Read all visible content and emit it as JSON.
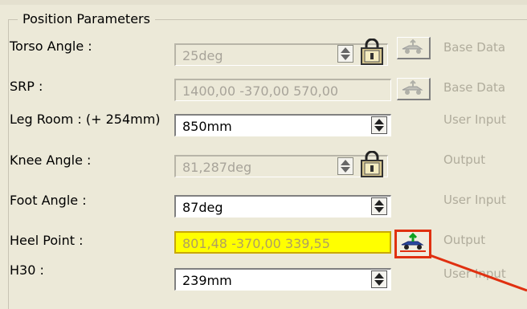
{
  "group": {
    "title": "Position Parameters"
  },
  "rows": [
    {
      "label": "Torso Angle :",
      "value": "25deg",
      "status": "Base Data"
    },
    {
      "label": "SRP :",
      "value": "1400,00  -370,00  570,00",
      "status": "Base Data"
    },
    {
      "label": "Leg Room : (+ 254mm)",
      "value": "850mm",
      "status": "User Input"
    },
    {
      "label": "Knee Angle :",
      "value": "81,287deg",
      "status": "Output"
    },
    {
      "label": "Foot Angle :",
      "value": "87deg",
      "status": "User Input"
    },
    {
      "label": "Heel Point :",
      "value": "801,48  -370,00  339,55",
      "status": "Output"
    },
    {
      "label": "H30 :",
      "value": "239mm",
      "status": "User Input"
    }
  ],
  "colors": {
    "highlight": "#ffff00",
    "annotation": "#e03010",
    "window": "#ece9d8"
  },
  "icons": [
    "spin-buttons-icon",
    "lock-icon",
    "base-data-vehicle-icon",
    "heel-point-vehicle-icon"
  ]
}
